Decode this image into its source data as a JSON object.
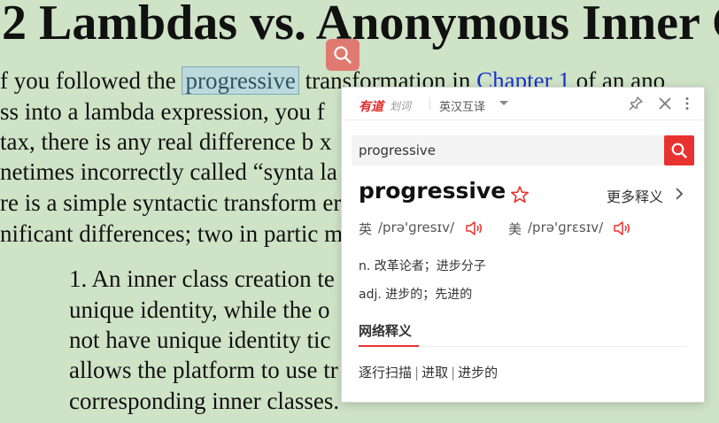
{
  "doc": {
    "title": "2 Lambdas vs. Anonymous Inner C",
    "para": [
      {
        "pre": "f you followed the ",
        "hl": "progressive",
        "mid": " transformation in ",
        "link": "Chapter 1",
        "post": " of an ano"
      },
      {
        "text": "ss into a lambda expression, you                                          f"
      },
      {
        "text": "tax, there is any real difference b                                        x"
      },
      {
        "text": "netimes incorrectly called “synta                                          la"
      },
      {
        "text": "re is a simple syntactic transform                                         ere"
      },
      {
        "text": "nificant differences; two in partic                                        m"
      }
    ],
    "list": [
      "1. An inner class creation                                   te",
      "unique identity, while the                                   o",
      "not have unique identity                                     tic",
      "allows the platform to use                                   tr",
      "corresponding inner classes."
    ]
  },
  "popup": {
    "brand": "有道",
    "brand_sub": "划词",
    "mode": "英汉互译",
    "search_value": "progressive",
    "word": "progressive",
    "more": "更多释义",
    "uk_label": "英",
    "uk_phonetic": "/prə'ɡresɪv/",
    "us_label": "美",
    "us_phonetic": "/prə'ɡrɛsɪv/",
    "definitions": [
      "n. 改革论者；进步分子",
      "adj. 进步的；先进的"
    ],
    "net_heading": "网络释义",
    "net_defs": [
      "逐行扫描",
      "进取",
      "进步的"
    ],
    "colors": {
      "accent": "#e8322f",
      "page_bg": "#cfe3c7",
      "highlight": "#bcd9de"
    }
  }
}
